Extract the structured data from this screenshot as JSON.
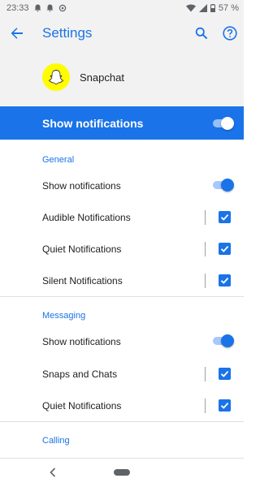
{
  "status_bar": {
    "time": "23:33",
    "battery": "57 %"
  },
  "app_bar": {
    "title": "Settings",
    "back_icon": "arrow-back-icon",
    "search_icon": "search-icon",
    "help_icon": "help-icon"
  },
  "app": {
    "name": "Snapchat",
    "logo_icon": "snapchat-ghost-icon",
    "brand_color": "#fffc00"
  },
  "master": {
    "label": "Show notifications",
    "enabled": true
  },
  "accent_color": "#1a73e8",
  "sections": [
    {
      "title": "General",
      "rows": [
        {
          "label": "Show notifications",
          "control": "switch",
          "on": true
        },
        {
          "label": "Audible Notifications",
          "control": "checkbox",
          "checked": true
        },
        {
          "label": "Quiet Notifications",
          "control": "checkbox",
          "checked": true
        },
        {
          "label": "Silent Notifications",
          "control": "checkbox",
          "checked": true
        }
      ]
    },
    {
      "title": "Messaging",
      "rows": [
        {
          "label": "Show notifications",
          "control": "switch",
          "on": true
        },
        {
          "label": "Snaps and Chats",
          "control": "checkbox",
          "checked": true
        },
        {
          "label": "Quiet Notifications",
          "control": "checkbox",
          "checked": true
        }
      ]
    },
    {
      "title": "Calling",
      "rows": []
    }
  ]
}
